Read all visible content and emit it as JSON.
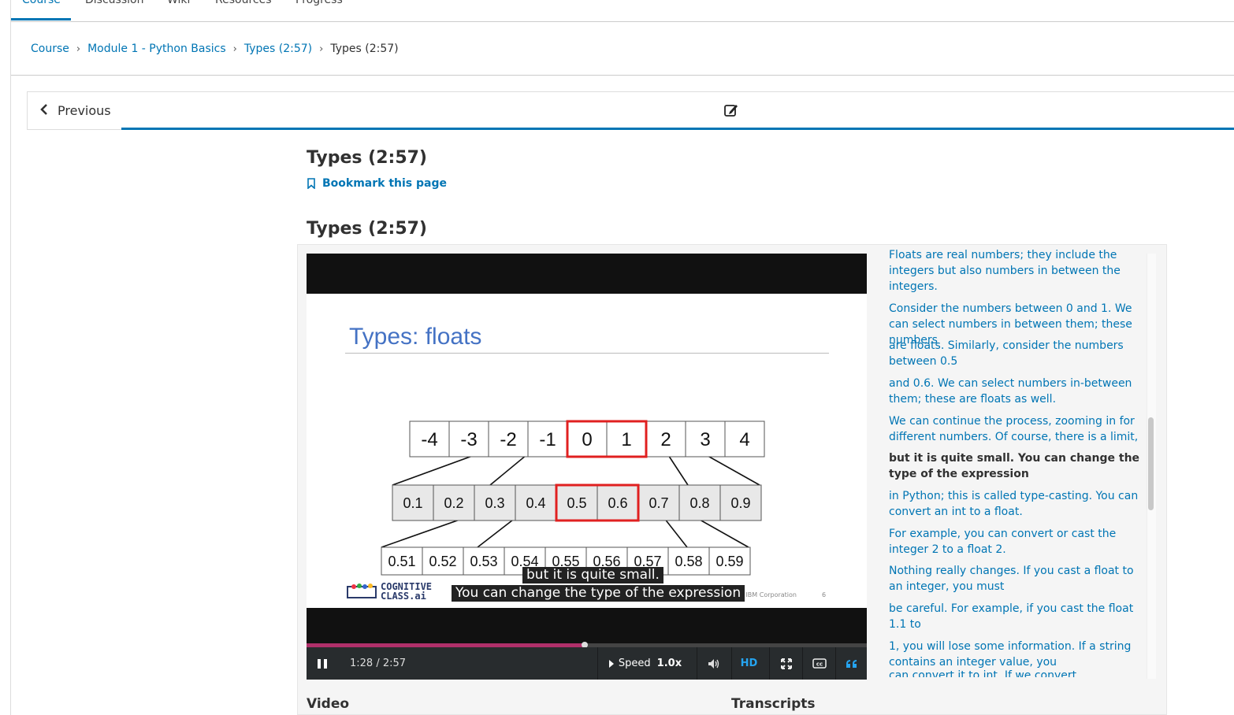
{
  "tabs": [
    {
      "label": "Course",
      "active": true
    },
    {
      "label": "Discussion"
    },
    {
      "label": "Wiki"
    },
    {
      "label": "Resources"
    },
    {
      "label": "Progress"
    }
  ],
  "breadcrumb": {
    "items": [
      "Course",
      "Module 1 - Python Basics",
      "Types (2:57)"
    ],
    "current": "Types (2:57)",
    "separator": "›"
  },
  "sequence": {
    "previous_label": "Previous",
    "edit_icon": "edit-icon"
  },
  "unit": {
    "title": "Types (2:57)",
    "bookmark_label": "Bookmark this page",
    "block_title": "Types (2:57)"
  },
  "slide": {
    "title": "Types: floats",
    "row1": [
      "-4",
      "-3",
      "-2",
      "-1",
      "0",
      "1",
      "2",
      "3",
      "4"
    ],
    "row2": [
      "0.1",
      "0.2",
      "0.3",
      "0.4",
      "0.5",
      "0.6",
      "0.7",
      "0.8",
      "0.9"
    ],
    "row3": [
      "0.51",
      "0.52",
      "0.53",
      "0.54",
      "0.55",
      "0.56",
      "0.57",
      "0.58",
      "0.59"
    ],
    "logo_line1": "COGNITIVE",
    "logo_line2": "CLASS.ai",
    "copyright": "© 2017 IBM Corporation",
    "page_number": "6",
    "highlight_color": "#e02020"
  },
  "captions": {
    "line1": "but it is quite small.",
    "line2": "You can change the type of the expression"
  },
  "player": {
    "time": "1:28 / 2:57",
    "progress_fraction": 0.497,
    "speed_label": "Speed",
    "speed_value": "1.0x",
    "hd_label": "HD",
    "accent_color": "#25a4f0",
    "progress_color": "#b0306a"
  },
  "transcript": [
    {
      "text": "Floats are real numbers; they include the integers but also numbers in between the integers."
    },
    {
      "text": "Consider the numbers between 0 and 1. We can select numbers in between them; these numbers"
    },
    {
      "text": "are floats. Similarly, consider the numbers between 0.5"
    },
    {
      "text": "and 0.6. We can select numbers in-between them; these are floats as well."
    },
    {
      "text": "We can continue the process, zooming in for different numbers. Of course, there is a limit,"
    },
    {
      "text": "but it is quite small. You can change the type of the expression",
      "current": true
    },
    {
      "text": "in Python; this is called type-casting. You can convert an int to a float."
    },
    {
      "text": "For example, you can convert or cast the integer 2 to a float 2."
    },
    {
      "text": "Nothing really changes. If you cast a float to an integer, you must"
    },
    {
      "text": "be careful. For example, if you cast the float 1.1 to"
    },
    {
      "text": "1, you will lose some information. If a string contains an integer value, you"
    },
    {
      "text": "can convert it to int. If we convert"
    }
  ],
  "labels": {
    "video": "Video",
    "transcripts": "Transcripts"
  }
}
